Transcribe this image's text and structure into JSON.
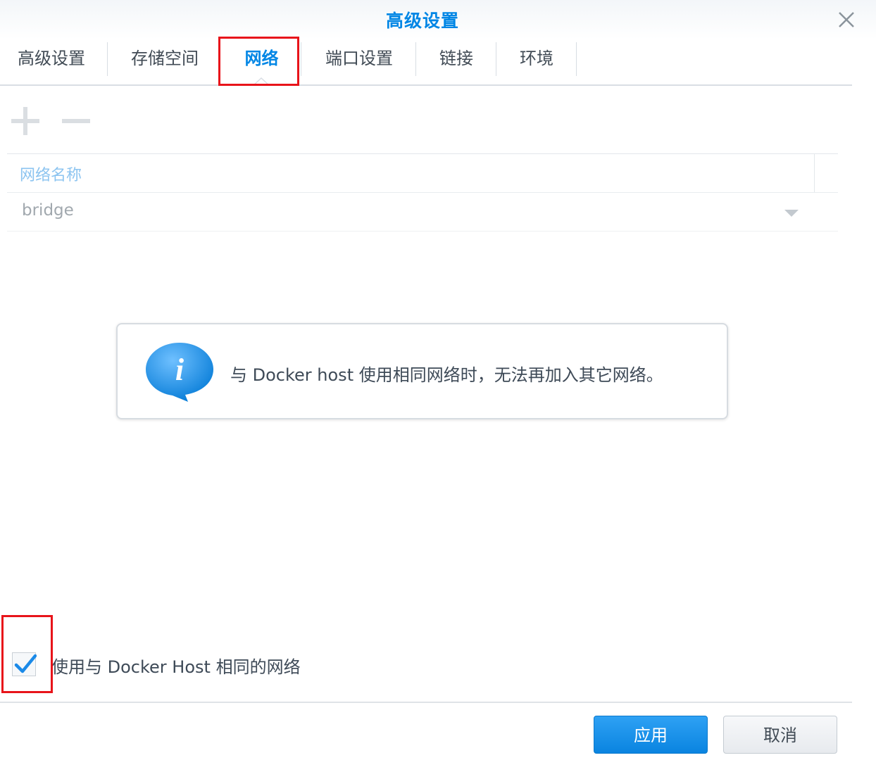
{
  "window": {
    "title": "高级设置"
  },
  "tabs": [
    {
      "label": "高级设置",
      "active": false
    },
    {
      "label": "存储空间",
      "active": false
    },
    {
      "label": "网络",
      "active": true
    },
    {
      "label": "端口设置",
      "active": false
    },
    {
      "label": "链接",
      "active": false
    },
    {
      "label": "环境",
      "active": false
    }
  ],
  "toolbar": {
    "add_icon": "plus-icon",
    "remove_icon": "minus-icon"
  },
  "grid": {
    "columns": [
      "网络名称"
    ],
    "rows": [
      {
        "network_name": "bridge"
      }
    ]
  },
  "info": {
    "icon": "info-bubble-icon",
    "message": "与 Docker host 使用相同网络时，无法再加入其它网络。"
  },
  "host_network": {
    "checked": true,
    "label": "使用与 Docker Host 相同的网络"
  },
  "footer": {
    "apply_label": "应用",
    "cancel_label": "取消"
  },
  "colors": {
    "accent": "#0086e5",
    "highlight_box": "#e8141a",
    "apply_button": "#1a8fe8"
  }
}
